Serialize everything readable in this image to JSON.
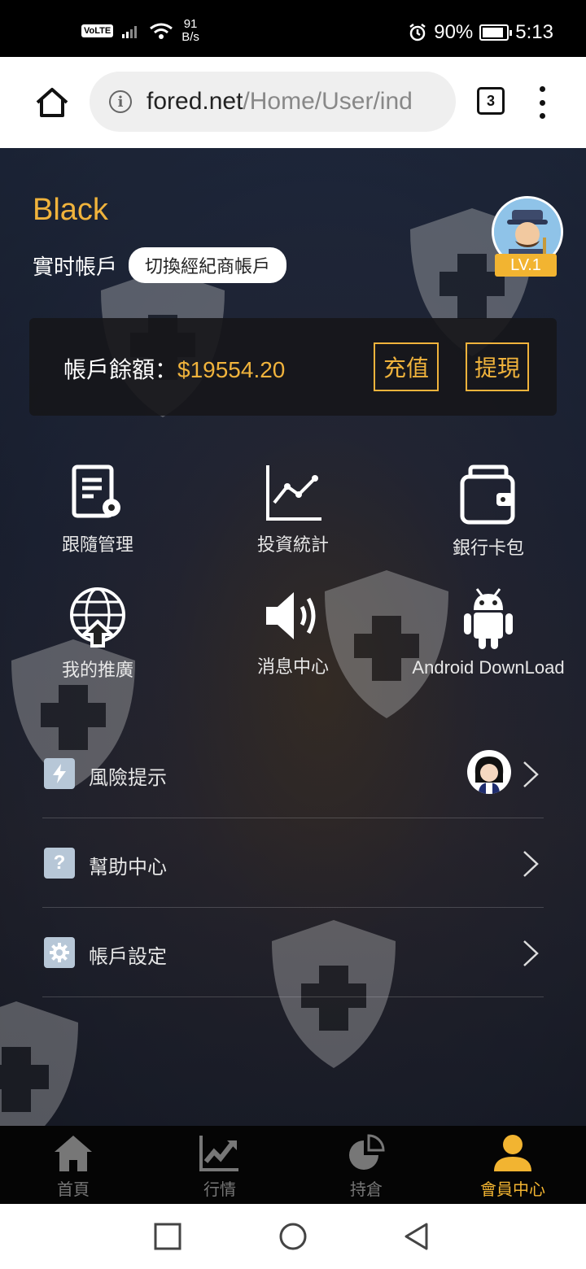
{
  "status_bar": {
    "volte": "VoLTE",
    "net_speed_value": "91",
    "net_speed_unit": "B/s",
    "battery": "90%",
    "battery_level": 0.9,
    "time": "5:13"
  },
  "browser": {
    "url_domain": "fored.net",
    "url_path": "/Home/User/ind",
    "tab_count": "3"
  },
  "profile": {
    "name": "Black",
    "account_type": "實时帳戶",
    "switch_label": "切換經紀商帳戶",
    "level": "LV.1"
  },
  "balance": {
    "label": "帳戶餘額：",
    "value": "$19554.20",
    "deposit_label": "充值",
    "withdraw_label": "提現"
  },
  "grid": [
    {
      "label": "跟隨管理",
      "icon": "document-settings-icon"
    },
    {
      "label": "投資統計",
      "icon": "line-chart-icon"
    },
    {
      "label": "銀行卡包",
      "icon": "wallet-icon"
    },
    {
      "label": "我的推廣",
      "icon": "globe-upload-icon"
    },
    {
      "label": "消息中心",
      "icon": "speaker-icon"
    },
    {
      "label": "Android DownLoad",
      "icon": "android-icon"
    }
  ],
  "menu": [
    {
      "label": "風險提示",
      "icon": "lightning-icon"
    },
    {
      "label": "幫助中心",
      "icon": "question-icon"
    },
    {
      "label": "帳戶設定",
      "icon": "gear-icon"
    }
  ],
  "bottom_nav": [
    {
      "label": "首頁",
      "icon": "home-icon"
    },
    {
      "label": "行情",
      "icon": "trend-icon"
    },
    {
      "label": "持倉",
      "icon": "pie-icon"
    },
    {
      "label": "會員中心",
      "icon": "user-icon",
      "active": true
    }
  ],
  "colors": {
    "accent": "#f0b33c",
    "nav_inactive": "#777777"
  }
}
